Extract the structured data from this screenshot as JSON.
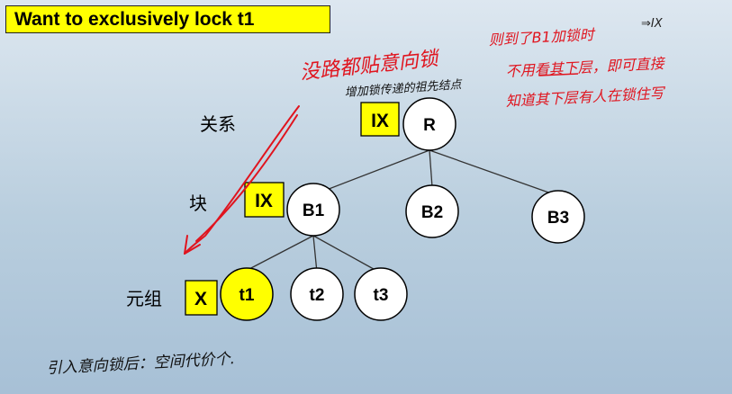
{
  "title": "Want to exclusively lock t1",
  "levels": {
    "relation": "关系",
    "block": "块",
    "tuple": "元组"
  },
  "nodes": {
    "root": "R",
    "b1": "B1",
    "b2": "B2",
    "b3": "B3",
    "t1": "t1",
    "t2": "t2",
    "t3": "t3"
  },
  "locks": {
    "root": "IX",
    "b1": "IX",
    "t1": "X"
  },
  "annotations": {
    "red_top": "没路都贴意向锁",
    "red_right_1": "则到了B1加锁时",
    "red_right_mark": "⇒IX",
    "red_right_2": "不用看其下层，即可直接",
    "red_right_3": "知道其下层有人在锁住写",
    "black_note": "增加锁传递的祖先结点",
    "bottom": "引入意向锁后：空间代价个."
  },
  "colors": {
    "highlight": "#ffff00",
    "ink_red": "#e0141e",
    "node_fill": "#ffffff",
    "stroke": "#000000"
  }
}
